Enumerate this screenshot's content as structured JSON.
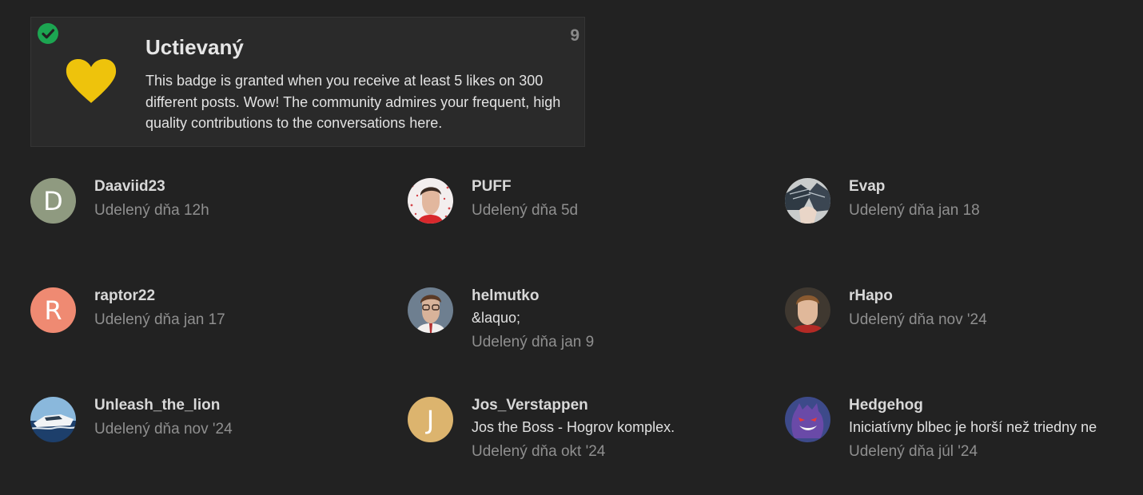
{
  "badge": {
    "title": "Uctievaný",
    "description": "This badge is granted when you receive at least 5 likes on 300 different posts. Wow! The community admires your frequent, high quality contributions to the conversations here.",
    "count": "9",
    "icon": "heart-icon",
    "icon_color": "#f1c40f",
    "granted_icon": "check-circle-icon",
    "granted_color": "#1ca551"
  },
  "grantees": [
    {
      "username": "Daaviid23",
      "avatar_letter": "D",
      "avatar_color": "#8f9a80",
      "user_title": "",
      "granted": "Udelený dňa 12h"
    },
    {
      "username": "PUFF",
      "avatar_letter": "",
      "avatar_color": "",
      "user_title": "",
      "granted": "Udelený dňa 5d"
    },
    {
      "username": "Evap",
      "avatar_letter": "",
      "avatar_color": "",
      "user_title": "",
      "granted": "Udelený dňa jan 18"
    },
    {
      "username": "raptor22",
      "avatar_letter": "R",
      "avatar_color": "#ef8a72",
      "user_title": "",
      "granted": "Udelený dňa jan 17"
    },
    {
      "username": "helmutko",
      "avatar_letter": "",
      "avatar_color": "",
      "user_title": "&laquo;",
      "granted": "Udelený dňa jan 9"
    },
    {
      "username": "rHapo",
      "avatar_letter": "",
      "avatar_color": "",
      "user_title": "",
      "granted": "Udelený dňa nov '24"
    },
    {
      "username": "Unleash_the_lion",
      "avatar_letter": "",
      "avatar_color": "",
      "user_title": "",
      "granted": "Udelený dňa nov '24"
    },
    {
      "username": "Jos_Verstappen",
      "avatar_letter": "J",
      "avatar_color": "#dcb46e",
      "user_title": "Jos the Boss - Hogrov komplex.",
      "granted": "Udelený dňa okt '24"
    },
    {
      "username": "Hedgehog",
      "avatar_letter": "",
      "avatar_color": "",
      "user_title": "Iniciatívny blbec je horší než triedny nepriateľ",
      "granted": "Udelený dňa júl '24"
    }
  ]
}
